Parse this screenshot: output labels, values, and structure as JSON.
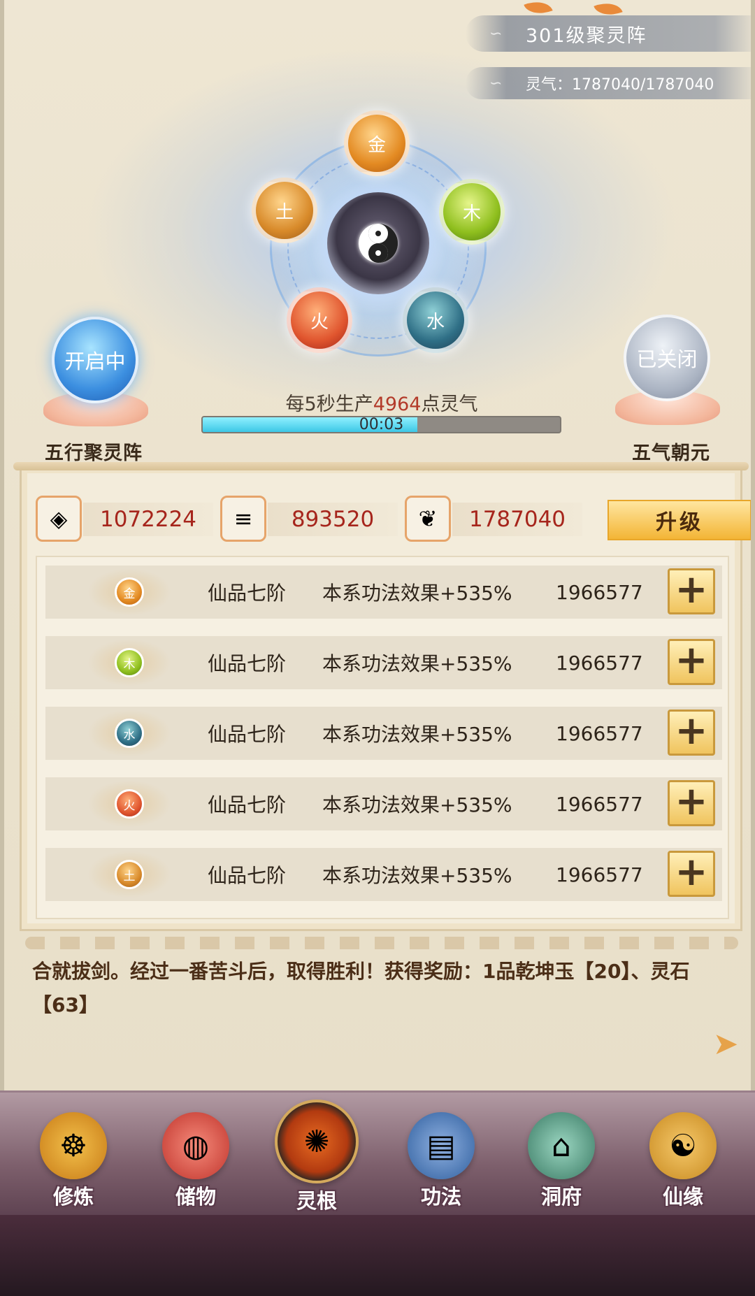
{
  "header": {
    "formation_level": "301级聚灵阵",
    "qi_label": "灵气：1787040/1787040"
  },
  "elements": {
    "gold": "金",
    "wood": "木",
    "water": "水",
    "fire": "火",
    "earth": "土"
  },
  "left_toggle": {
    "state": "开启中",
    "label": "五行聚灵阵"
  },
  "right_toggle": {
    "state": "已关闭",
    "label": "五气朝元"
  },
  "production": {
    "prefix": "每5秒生产",
    "amount": "4964",
    "suffix": "点灵气",
    "timer": "00:03",
    "progress": 0.6
  },
  "resources": [
    {
      "icon": "spirit-stone-icon",
      "value": "1072224"
    },
    {
      "icon": "wood-logs-icon",
      "value": "893520"
    },
    {
      "icon": "herb-leaf-icon",
      "value": "1787040"
    }
  ],
  "upgrade_label": "升级",
  "rows": [
    {
      "element": "金",
      "grade": "仙品七阶",
      "effect": "本系功法效果+535%",
      "value": "1966577"
    },
    {
      "element": "木",
      "grade": "仙品七阶",
      "effect": "本系功法效果+535%",
      "value": "1966577"
    },
    {
      "element": "水",
      "grade": "仙品七阶",
      "effect": "本系功法效果+535%",
      "value": "1966577"
    },
    {
      "element": "火",
      "grade": "仙品七阶",
      "effect": "本系功法效果+535%",
      "value": "1966577"
    },
    {
      "element": "土",
      "grade": "仙品七阶",
      "effect": "本系功法效果+535%",
      "value": "1966577"
    }
  ],
  "plus_label": "+",
  "log": "合就拔剑。经过一番苦斗后，取得胜利！获得奖励：1品乾坤玉【20】、灵石【63】",
  "nav": [
    {
      "label": "修炼",
      "icon": "meditation-icon"
    },
    {
      "label": "储物",
      "icon": "storage-bag-icon"
    },
    {
      "label": "灵根",
      "icon": "spirit-root-icon"
    },
    {
      "label": "功法",
      "icon": "scripture-book-icon"
    },
    {
      "label": "洞府",
      "icon": "cave-house-icon"
    },
    {
      "label": "仙缘",
      "icon": "gourd-icon"
    }
  ],
  "colors": {
    "accent_red": "#b33a2a",
    "upgrade_gold": "#f3b536",
    "progress_cyan": "#3dc7e6"
  }
}
